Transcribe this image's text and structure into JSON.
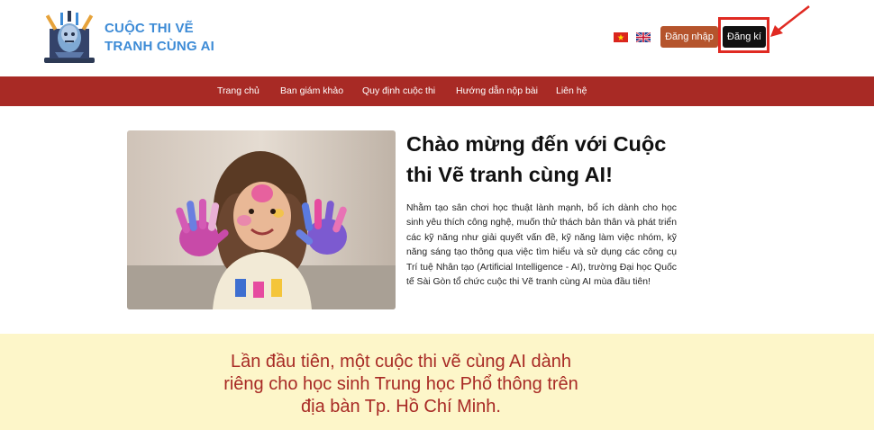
{
  "header": {
    "logo_line1": "CUỘC THI VẼ",
    "logo_line2": "TRANH CÙNG AI",
    "login_label": "Đăng nhập",
    "register_label": "Đăng kí"
  },
  "nav": {
    "items": [
      {
        "label": "Trang chủ"
      },
      {
        "label": "Ban giám khảo"
      },
      {
        "label": "Quy định cuộc thi"
      },
      {
        "label": "Hướng dẫn nộp bài"
      },
      {
        "label": "Liên hệ"
      }
    ]
  },
  "hero": {
    "title": "Chào mừng đến với Cuộc thi Vẽ tranh cùng AI!",
    "description": "Nhằm tạo sân chơi học thuật lành mạnh, bổ ích dành cho học sinh yêu thích công nghệ, muốn thử thách bản thân và phát triển các kỹ năng như giải quyết vấn đề, kỹ năng làm việc nhóm, kỹ năng sáng tạo thông qua việc tìm hiểu và sử dụng các công cụ Trí tuệ Nhân tạo (Artificial Intelligence - AI), trường Đại học Quốc tế Sài Gòn tổ chức cuộc thi Vẽ tranh cùng AI mùa đầu tiên!"
  },
  "banner": {
    "text": "Lần đầu tiên, một cuộc thi vẽ cùng AI dành riêng cho học sinh Trung học Phổ thông trên địa bàn Tp. Hồ Chí Minh."
  },
  "colors": {
    "brand_red": "#a82a25",
    "logo_blue": "#3d8bd6",
    "login_bg": "#b5542c",
    "register_bg": "#111111",
    "banner_bg": "#fdf6c9",
    "annotation_red": "#e02a22"
  },
  "icons": {
    "logo": "robot-artist-logo",
    "flag_vi": "vietnam-flag-icon",
    "flag_en": "uk-flag-icon",
    "annotation": "red-arrow-icon"
  }
}
